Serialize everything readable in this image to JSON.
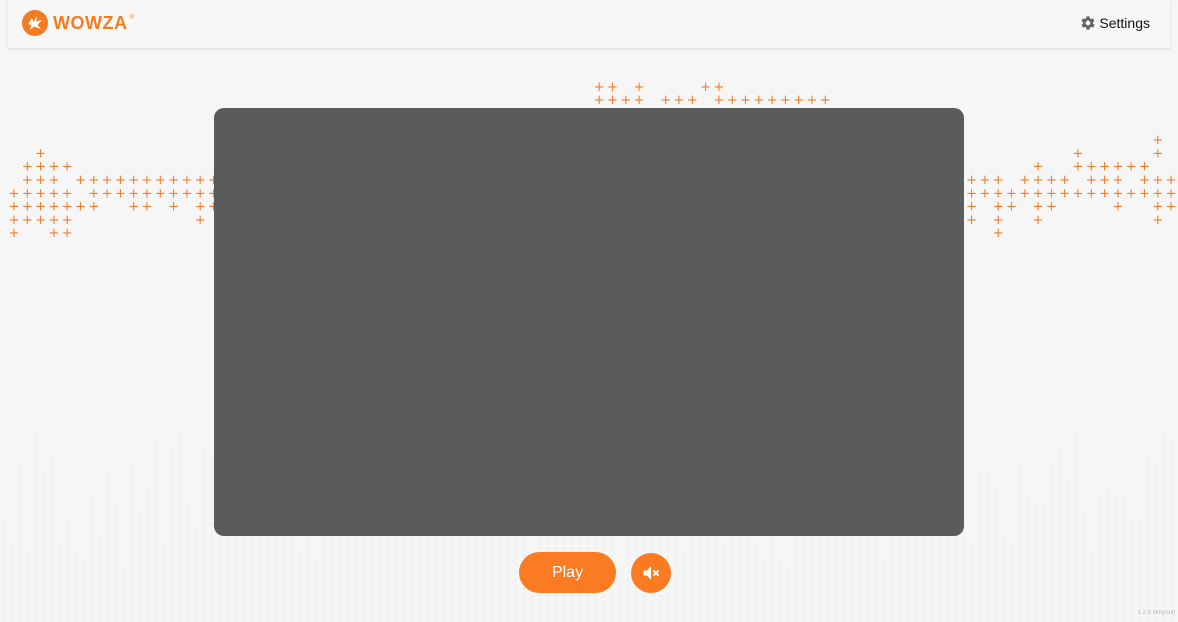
{
  "header": {
    "logo_text": "WOWZA",
    "logo_tm": "®",
    "settings_label": "Settings",
    "settings_icon": "gear-icon"
  },
  "player": {
    "play_label": "Play",
    "mute_icon": "volume-mute-icon"
  },
  "footer": {
    "version": "1.2.9 kkfqmufj"
  },
  "colors": {
    "accent": "#fa7b22",
    "video_bg": "#5b5b5b",
    "page_bg": "#f6f6f6"
  }
}
